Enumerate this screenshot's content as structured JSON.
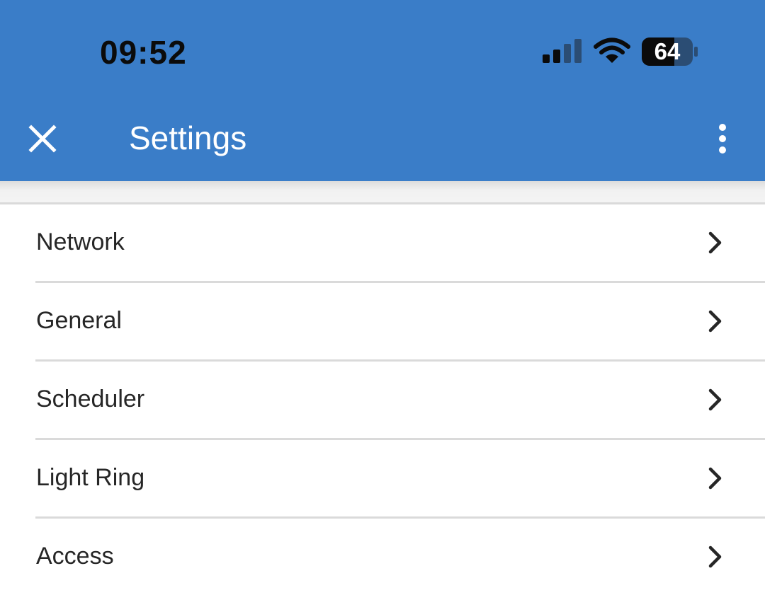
{
  "status_bar": {
    "time": "09:52",
    "battery_level": "64",
    "icons": [
      "signal-icon",
      "wifi-icon",
      "battery-icon"
    ]
  },
  "app_bar": {
    "title": "Settings",
    "close_icon": "close-icon",
    "more_icon": "more-vert-icon",
    "color": "#3a7dc8"
  },
  "settings_list": {
    "items": [
      {
        "label": "Network"
      },
      {
        "label": "General"
      },
      {
        "label": "Scheduler"
      },
      {
        "label": "Light Ring"
      },
      {
        "label": "Access"
      }
    ],
    "item_icon": "chevron-right-icon"
  }
}
